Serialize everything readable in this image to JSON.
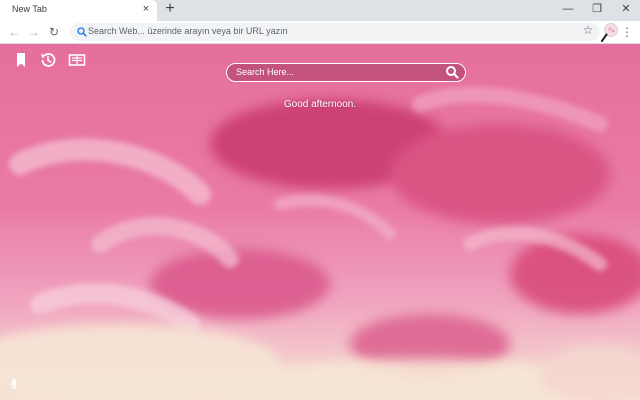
{
  "browser": {
    "tab": {
      "title": "New Tab",
      "close_glyph": "×"
    },
    "new_tab_glyph": "+",
    "window_controls": {
      "minimize": "—",
      "restore": "❐",
      "close": "✕"
    },
    "nav": {
      "back": "←",
      "forward": "→",
      "reload": "↻"
    },
    "omnibox": {
      "placeholder": "Search Web... üzerinde arayın veya bir URL yazın"
    },
    "star_glyph": "☆",
    "menu_glyph": "⋮",
    "extension_icon": "magnifier-extension-icon"
  },
  "page": {
    "left_icons": [
      "bookmark-icon",
      "history-icon",
      "apps-icon"
    ],
    "search": {
      "placeholder": "Search Here..."
    },
    "greeting": "Good afternoon.",
    "corner_icon": "settings-icon"
  },
  "colors": {
    "tabstrip": "#dee1e6",
    "toolbar": "#ffffff",
    "background_pink": "#e46c9a",
    "background_cream": "#f6e6d4"
  }
}
